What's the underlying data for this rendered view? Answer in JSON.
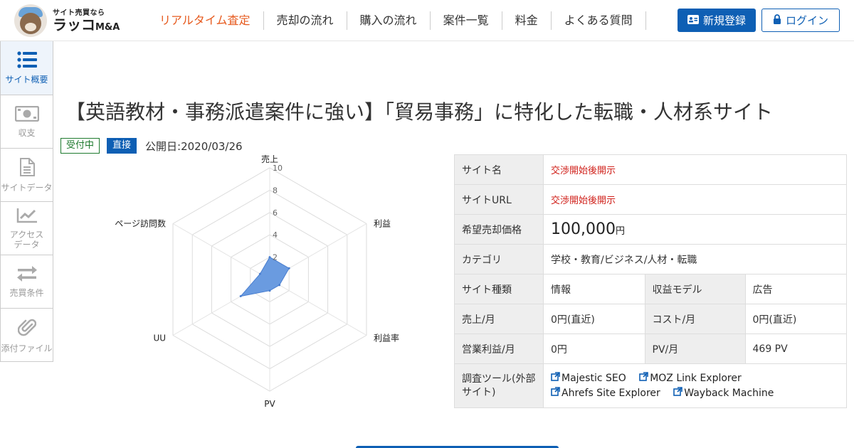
{
  "logo": {
    "tagline": "サイト売買なら",
    "name": "ラッコ",
    "suffix": "M&A"
  },
  "nav": {
    "items": [
      {
        "label": "リアルタイム査定",
        "active": true
      },
      {
        "label": "売却の流れ"
      },
      {
        "label": "購入の流れ"
      },
      {
        "label": "案件一覧"
      },
      {
        "label": "料金"
      },
      {
        "label": "よくある質問"
      }
    ],
    "register_label": "新規登録",
    "login_label": "ログイン"
  },
  "sidebar": {
    "items": [
      {
        "label": "サイト概要",
        "icon": "list-icon",
        "active": true
      },
      {
        "label": "収支",
        "icon": "money-icon"
      },
      {
        "label": "サイトデータ",
        "icon": "document-icon"
      },
      {
        "label": "アクセス\nデータ",
        "icon": "chart-icon"
      },
      {
        "label": "売買条件",
        "icon": "exchange-icon"
      },
      {
        "label": "添付ファイル",
        "icon": "paperclip-icon"
      }
    ]
  },
  "listing": {
    "title": "【英語教材・事務派遣案件に強い】「貿易事務」に特化した転職・人材系サイト",
    "status_badge": "受付中",
    "type_badge": "直接",
    "published": "公開日:2020/03/26"
  },
  "chart_data": {
    "type": "radar",
    "axes": [
      "売上",
      "利益",
      "利益率",
      "PV",
      "UU",
      "ページ訪問数"
    ],
    "values": [
      2,
      2,
      1,
      1,
      3,
      1
    ],
    "rmax": 10,
    "ticks": [
      "2",
      "4",
      "6",
      "8",
      "10"
    ],
    "color": "#6a9be0"
  },
  "info": {
    "site_name_label": "サイト名",
    "site_name_value": "交渉開始後開示",
    "site_url_label": "サイトURL",
    "site_url_value": "交渉開始後開示",
    "price_label": "希望売却価格",
    "price_value": "100,000",
    "price_unit": "円",
    "category_label": "カテゴリ",
    "category_value": "学校・教育/ビジネス/人材・転職",
    "site_type_label": "サイト種類",
    "site_type_value": "情報",
    "revenue_model_label": "収益モデル",
    "revenue_model_value": "広告",
    "sales_label": "売上/月",
    "sales_value": "0円(直近)",
    "cost_label": "コスト/月",
    "cost_value": "0円(直近)",
    "profit_label": "営業利益/月",
    "profit_value": "0円",
    "pv_label": "PV/月",
    "pv_value": "469 PV",
    "tools_label": "調査ツール(外部サイト)",
    "tools": [
      "Majestic SEO",
      "MOZ Link Explorer",
      "Ahrefs Site Explorer",
      "Wayback Machine"
    ]
  }
}
